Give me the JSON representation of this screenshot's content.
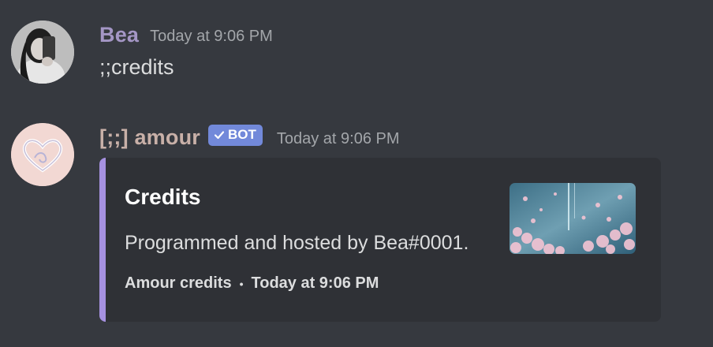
{
  "colors": {
    "background": "#36393f",
    "bea_name": "#a496c5",
    "amour_name": "#c8b0a8",
    "bot_badge": "#7289da",
    "embed_accent": "#a691e0",
    "embed_background": "#2f3136"
  },
  "messages": [
    {
      "author": "Bea",
      "timestamp": "Today at 9:06 PM",
      "text": ";;credits",
      "avatar": "user-photo-avatar"
    },
    {
      "author": "[;;] amour",
      "bot_badge": "BOT",
      "badge_icon": "checkmark-icon",
      "timestamp": "Today at 9:06 PM",
      "avatar": "heart-logo-avatar",
      "embed": {
        "title": "Credits",
        "description": "Programmed and hosted by Bea#0001.",
        "footer_text": "Amour credits",
        "footer_separator": "•",
        "footer_timestamp": "Today at 9:06 PM",
        "thumbnail": "cherry-blossom-thumbnail"
      }
    }
  ]
}
